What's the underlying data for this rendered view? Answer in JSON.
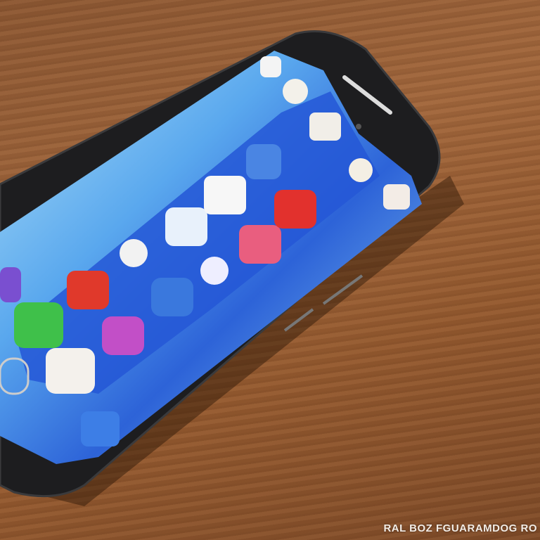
{
  "scene": {
    "subject": "smartphone",
    "colors": {
      "wood": "#93592f",
      "phone_body": "#1c1c1e",
      "screen_blue": "#2f6fe0",
      "screen_light": "#9ed4f2"
    }
  },
  "watermark": {
    "text": "RAL BOZ FGUARAMDOG RO"
  }
}
